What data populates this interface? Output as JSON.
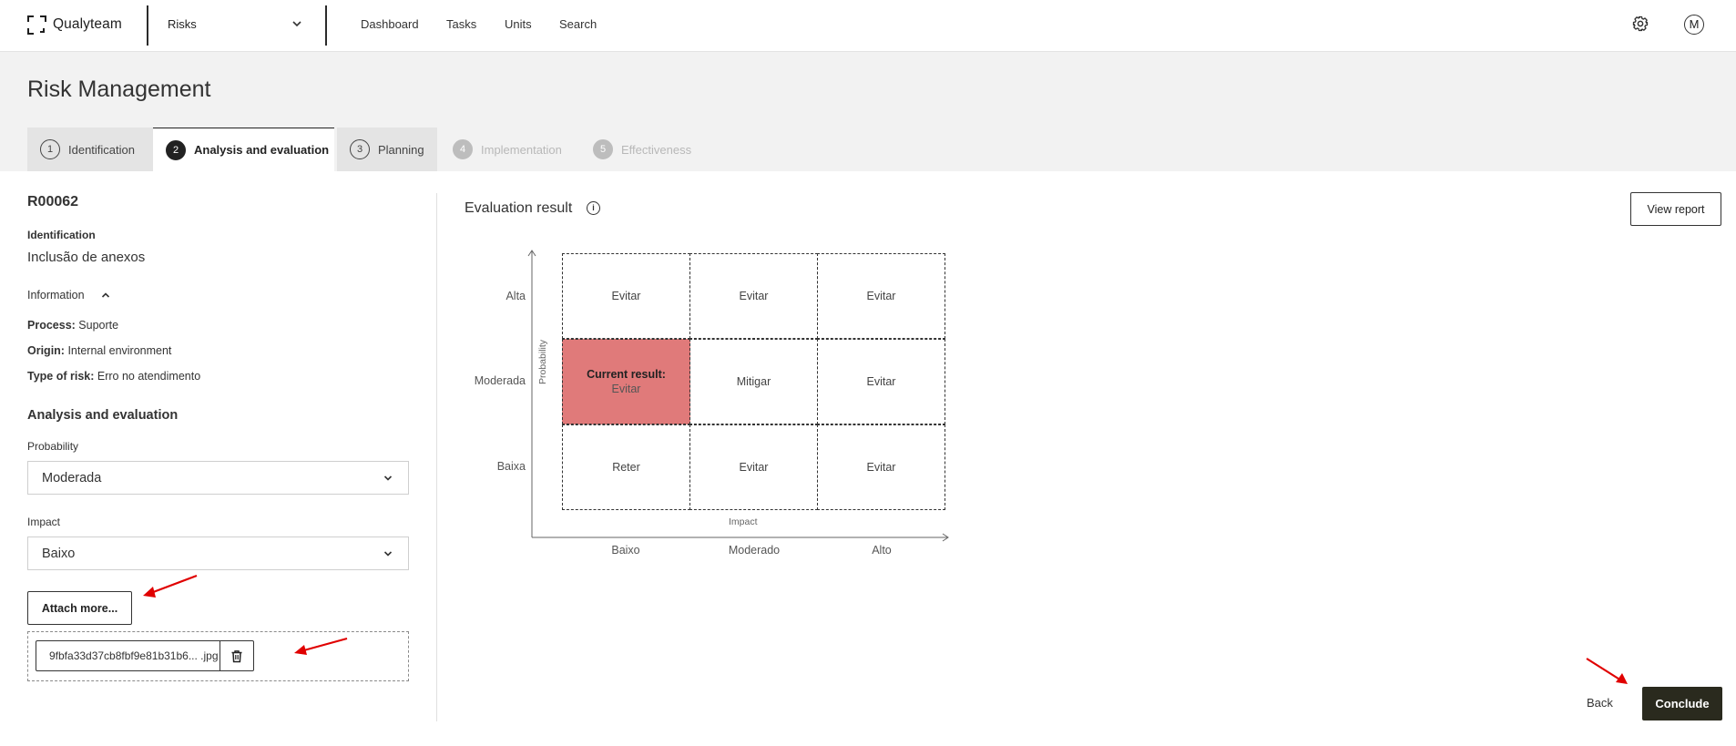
{
  "app": {
    "logo_text": "Qualyteam",
    "module": "Risks",
    "nav": [
      "Dashboard",
      "Tasks",
      "Units",
      "Search"
    ],
    "avatar_initial": "M"
  },
  "page": {
    "title": "Risk Management",
    "tabs": [
      {
        "num": "1",
        "label": "Identification",
        "state": "done"
      },
      {
        "num": "2",
        "label": "Analysis and evaluation",
        "state": "active"
      },
      {
        "num": "3",
        "label": "Planning",
        "state": "done"
      },
      {
        "num": "4",
        "label": "Implementation",
        "state": "disabled"
      },
      {
        "num": "5",
        "label": "Effectiveness",
        "state": "disabled"
      }
    ]
  },
  "risk": {
    "code": "R00062",
    "identification_label": "Identification",
    "identification_value": "Inclusão de anexos",
    "information_label": "Information",
    "process_label": "Process:",
    "process_value": "Suporte",
    "origin_label": "Origin:",
    "origin_value": "Internal environment",
    "type_label": "Type of risk:",
    "type_value": "Erro no atendimento"
  },
  "analysis": {
    "section_title": "Analysis and evaluation",
    "probability_label": "Probability",
    "probability_value": "Moderada",
    "impact_label": "Impact",
    "impact_value": "Baixo",
    "attach_label": "Attach more...",
    "file_name": "9fbfa33d37cb8fbf9e81b31b6... .jpg"
  },
  "evaluation": {
    "title": "Evaluation result",
    "view_report": "View report",
    "probability_axis": "Probability",
    "impact_axis": "Impact",
    "rows": [
      "Alta",
      "Moderada",
      "Baixa"
    ],
    "cols": [
      "Baixo",
      "Moderado",
      "Alto"
    ],
    "cells": [
      [
        "Evitar",
        "Evitar",
        "Evitar"
      ],
      [
        "Evitar",
        "Mitigar",
        "Evitar"
      ],
      [
        "Reter",
        "Evitar",
        "Evitar"
      ]
    ],
    "current_label": "Current result:",
    "current_value": "Evitar",
    "current_cell": {
      "row": "Moderada",
      "col": "Baixo"
    },
    "current_color": "#e07a7a"
  },
  "actions": {
    "back": "Back",
    "conclude": "Conclude"
  },
  "colors": {
    "primary_dark": "#2a2a1e",
    "annotation_arrow": "#e00000"
  }
}
